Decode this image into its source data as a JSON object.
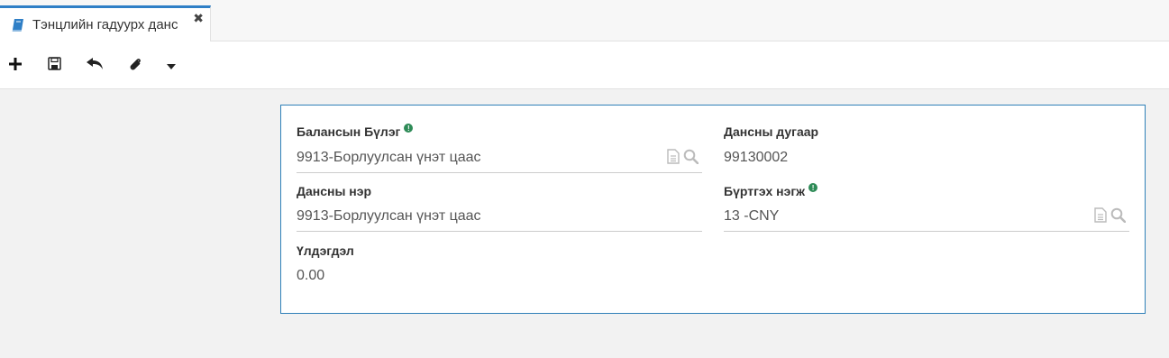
{
  "tab": {
    "title": "Тэнцлийн гадуурх данс",
    "icon": "book-icon",
    "close_icon": "close-icon",
    "accent": "#2f7fc6"
  },
  "toolbar": {
    "buttons": [
      "add-icon",
      "save-icon",
      "undo-icon",
      "attachment-icon",
      "caret-down-icon"
    ]
  },
  "form": {
    "balance_group": {
      "label": "Балансын Бүлэг",
      "value": "9913-Борлуулсан үнэт цаас",
      "required": true
    },
    "account_number": {
      "label": "Дансны дугаар",
      "value": "99130002"
    },
    "account_name": {
      "label": "Дансны нэр",
      "value": "9913-Борлуулсан үнэт цаас"
    },
    "registration_unit": {
      "label": "Бүртгэх нэгж",
      "value": "13 -CNY",
      "required": true
    },
    "balance": {
      "label": "Үлдэгдэл",
      "value": "0.00"
    },
    "required_color": "#2e8b57",
    "border_color": "#2f80b8"
  }
}
